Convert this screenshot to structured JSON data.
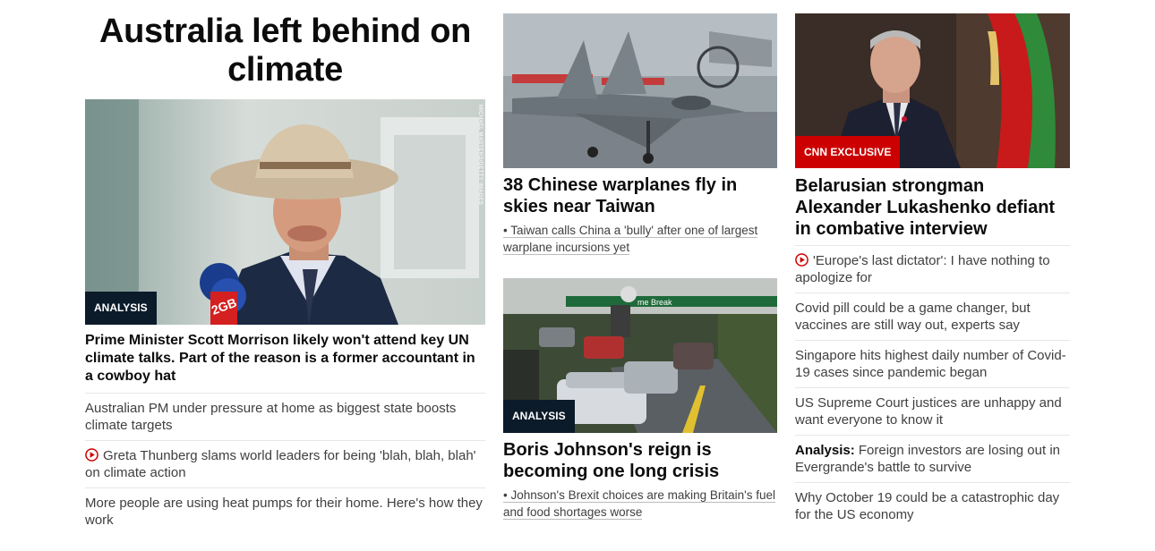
{
  "left": {
    "title": "Australia left behind on climate",
    "badge": "ANALYSIS",
    "photo_credit": "MICHAEL MASTERS/GETTY IMAGES",
    "headline": "Prime Minister Scott Morrison likely won't attend key UN climate talks. Part of the reason is a former accountant in a cowboy hat",
    "links": [
      {
        "text": "Australian PM under pressure at home as biggest state boosts climate targets",
        "video": false
      },
      {
        "text": "Greta Thunberg slams world leaders for being 'blah, blah, blah' on climate action",
        "video": true
      },
      {
        "text": "More people are using heat pumps for their home. Here's how they work",
        "video": false
      }
    ]
  },
  "mid": {
    "story1": {
      "headline": "38 Chinese warplanes fly in skies near Taiwan",
      "sub": "• Taiwan calls China a 'bully' after one of largest warplane incursions yet"
    },
    "story2": {
      "badge": "ANALYSIS",
      "headline": "Boris Johnson's reign is becoming one long crisis",
      "sub": "• Johnson's Brexit choices are making Britain's fuel and food shortages worse",
      "station_sign": "me Break"
    }
  },
  "right": {
    "badge": "CNN EXCLUSIVE",
    "headline": "Belarusian strongman Alexander Lukashenko defiant in combative interview",
    "links": [
      {
        "prefix": "",
        "text": "'Europe's last dictator': I have nothing to apologize for",
        "video": true
      },
      {
        "prefix": "",
        "text": "Covid pill could be a game changer, but vaccines are still way out, experts say",
        "video": false
      },
      {
        "prefix": "",
        "text": "Singapore hits highest daily number of Covid-19 cases since pandemic began",
        "video": false
      },
      {
        "prefix": "",
        "text": "US Supreme Court justices are unhappy and want everyone to know it",
        "video": false
      },
      {
        "prefix": "Analysis:",
        "text": " Foreign investors are losing out in Evergrande's battle to survive",
        "video": false
      },
      {
        "prefix": "",
        "text": "Why October 19 could be a catastrophic day for the US economy",
        "video": false
      }
    ]
  },
  "colors": {
    "accent_red": "#cc0000",
    "badge_dark": "#0c1b2a"
  },
  "icons": {
    "video": "play-circle-icon"
  }
}
